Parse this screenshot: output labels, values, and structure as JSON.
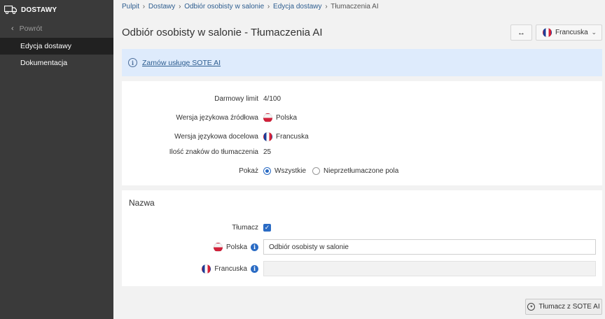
{
  "sidebar": {
    "title": "DOSTAWY",
    "back_label": "Powrót",
    "items": [
      {
        "label": "Edycja dostawy",
        "active": true
      },
      {
        "label": "Dokumentacja",
        "active": false
      }
    ]
  },
  "breadcrumb": {
    "items": [
      "Pulpit",
      "Dostawy",
      "Odbiór osobisty w salonie",
      "Edycja dostawy"
    ],
    "current": "Tłumaczenia AI",
    "separator": "›"
  },
  "page": {
    "title": "Odbiór osobisty w salonie - Tłumaczenia AI"
  },
  "toolbar": {
    "swap_symbol": "↔",
    "language_select": "Francuska"
  },
  "info": {
    "link_text": "Zamów usługę SOTE AI"
  },
  "details": {
    "free_limit_label": "Darmowy limit",
    "free_limit_value": "4/100",
    "source_lang_label": "Wersja językowa źródłowa",
    "source_lang_value": "Polska",
    "target_lang_label": "Wersja językowa docelowa",
    "target_lang_value": "Francuska",
    "char_count_label": "Ilość znaków do tłumaczenia",
    "char_count_value": "25",
    "show_label": "Pokaż",
    "show_options": [
      "Wszystkie",
      "Nieprzetłumaczone pola"
    ],
    "show_selected": "Wszystkie"
  },
  "name_section": {
    "title": "Nazwa",
    "translator_label": "Tłumacz",
    "translator_checked": true,
    "polish_label": "Polska",
    "polish_value": "Odbiór osobisty w salonie",
    "french_label": "Francuska",
    "french_value": ""
  },
  "footer": {
    "translate_button": "Tłumacz z SOTE AI"
  },
  "colors": {
    "sidebar_bg": "#3a3a3a",
    "sidebar_active": "#212121",
    "accent": "#2a6bc4",
    "info_bg": "#deebfc",
    "link": "#2d5d8f"
  }
}
